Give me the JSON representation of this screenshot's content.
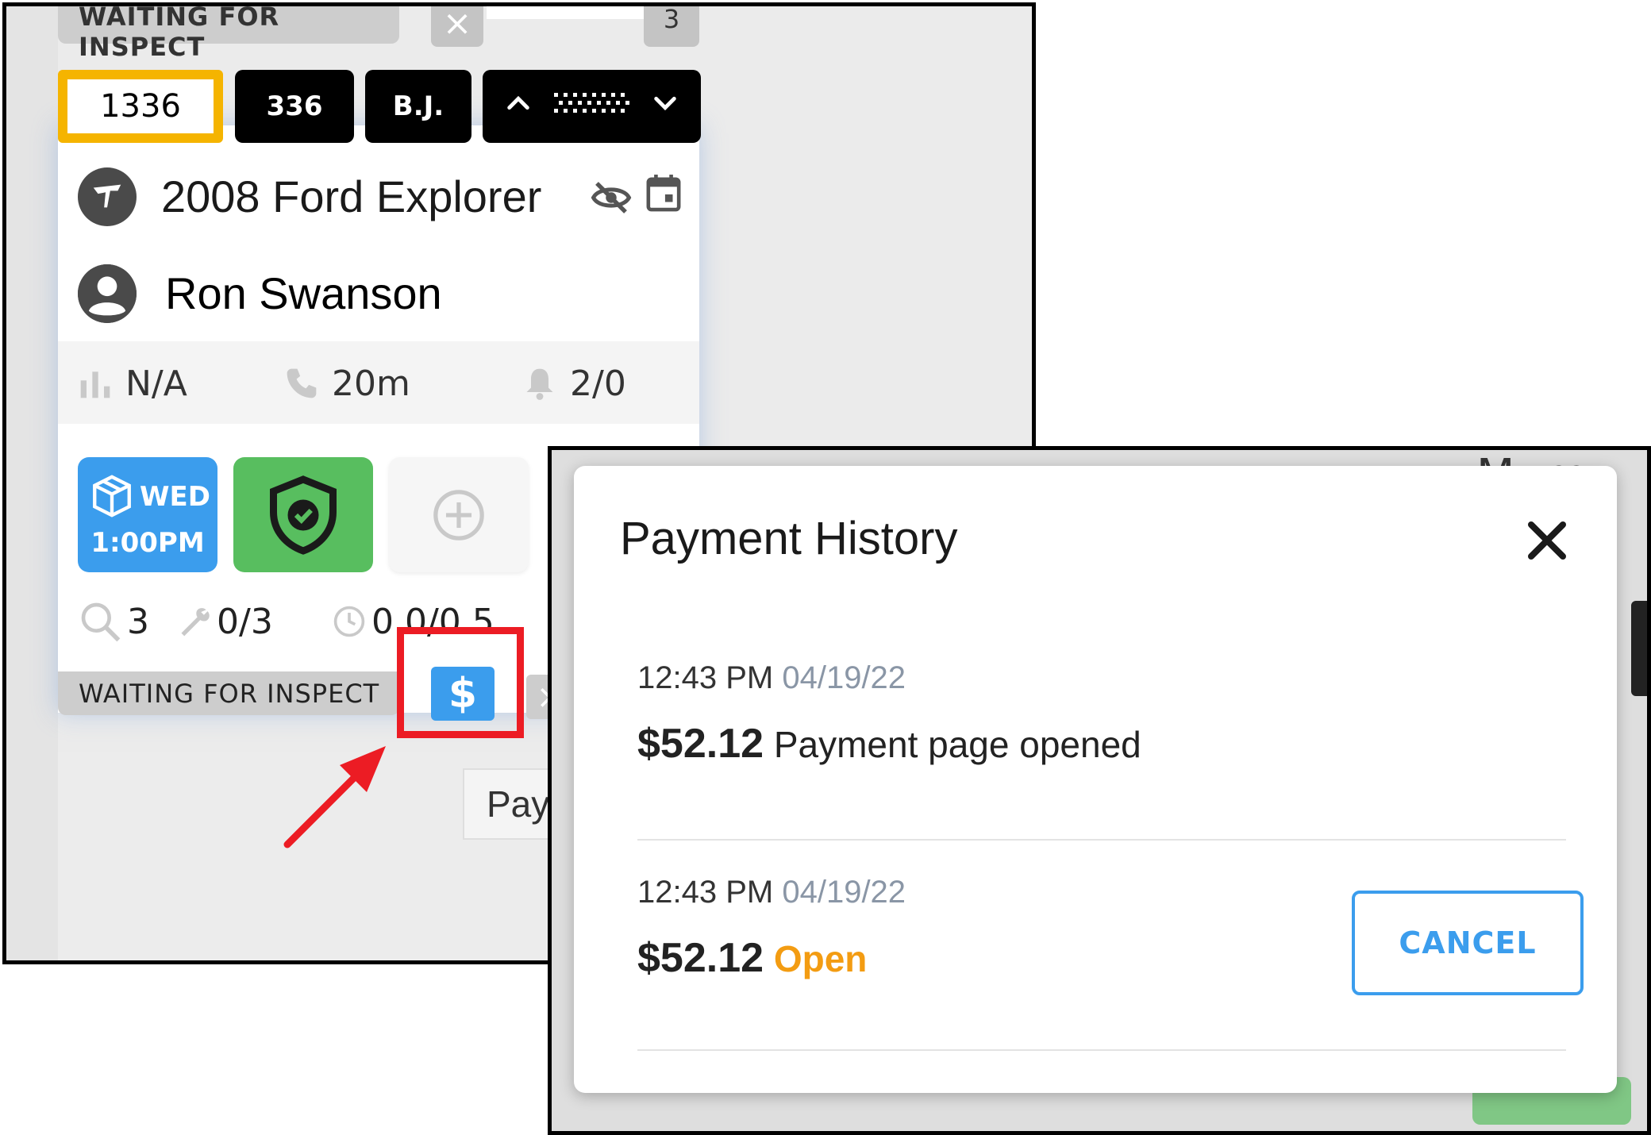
{
  "previous_card": {
    "status_label": "WAITING FOR INSPECT",
    "count": "3"
  },
  "card": {
    "ro_number": "1336",
    "hat_number": "336",
    "advisor_initials": "B.J.",
    "vehicle": "2008 Ford Explorer",
    "customer": "Ron Swanson",
    "stats": {
      "rating": "N/A",
      "call": "20m",
      "notifications": "2/0"
    },
    "promise": {
      "day": "WED",
      "time": "1:00PM"
    },
    "counters": {
      "inspections": "3",
      "labor": "0/3",
      "hours": "0.0/0.5"
    },
    "status_label": "WAITING FOR INSPECT",
    "pay_icon_glyph": "$",
    "tooltip_text": "Pay"
  },
  "background": {
    "behind_text": "Murr"
  },
  "payment_history": {
    "title": "Payment History",
    "entries": [
      {
        "time": "12:43 PM",
        "date": "04/19/22",
        "amount": "$52.12",
        "status": "Payment page opened"
      },
      {
        "time": "12:43 PM",
        "date": "04/19/22",
        "amount": "$52.12",
        "status": "Open",
        "action": "CANCEL"
      }
    ]
  },
  "colors": {
    "highlight": "#ec1c24",
    "accent_blue": "#3b9ded",
    "ro_border": "#f5b400",
    "open_status": "#f39c12",
    "shield_green": "#58be5f"
  },
  "icons": [
    "vehicle-icon",
    "hide-icon",
    "calendar-icon",
    "user-icon",
    "bar-chart-icon",
    "phone-icon",
    "bell-icon",
    "box-icon",
    "shield-check-icon",
    "add-icon",
    "search-icon",
    "wrench-icon",
    "clock-icon",
    "dollar-icon",
    "close-icon",
    "arrow-icon"
  ]
}
